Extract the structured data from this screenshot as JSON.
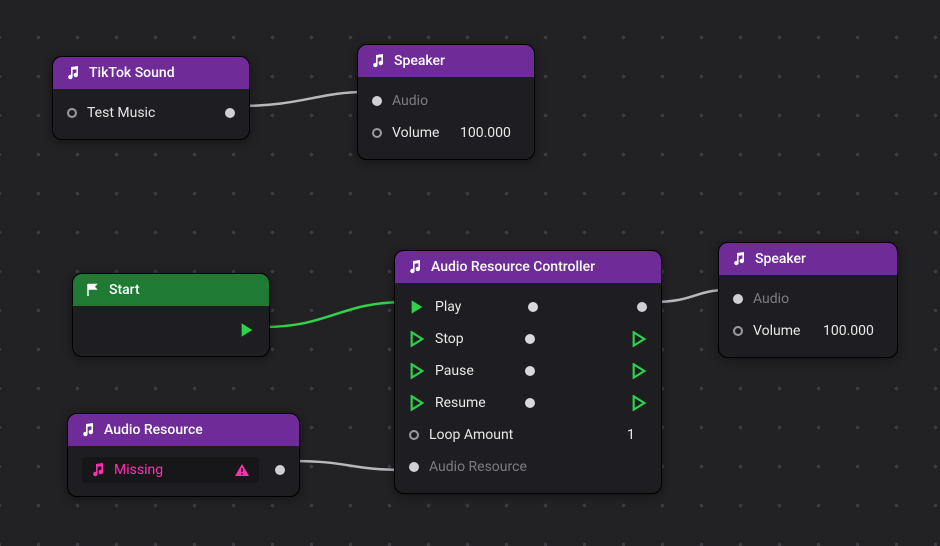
{
  "colors": {
    "purple": "#6f2b97",
    "green": "#1f7a33",
    "exec_green": "#2fd24a",
    "pink": "#ff2fb0",
    "wire_grey": "#b8b8bd"
  },
  "nodes": {
    "tiktok_sound": {
      "title": "TikTok Sound",
      "rows": {
        "test_music": "Test Music"
      }
    },
    "speaker_top": {
      "title": "Speaker",
      "rows": {
        "audio": "Audio",
        "volume": "Volume",
        "volume_value": "100.000"
      }
    },
    "start": {
      "title": "Start"
    },
    "audio_resource": {
      "title": "Audio Resource",
      "rows": {
        "missing": "Missing"
      }
    },
    "controller": {
      "title": "Audio Resource Controller",
      "rows": {
        "play": "Play",
        "stop": "Stop",
        "pause": "Pause",
        "resume": "Resume",
        "loop_amount": "Loop Amount",
        "loop_value": "1",
        "audio_resource": "Audio Resource"
      }
    },
    "speaker_right": {
      "title": "Speaker",
      "rows": {
        "audio": "Audio",
        "volume": "Volume",
        "volume_value": "100.000"
      }
    }
  }
}
